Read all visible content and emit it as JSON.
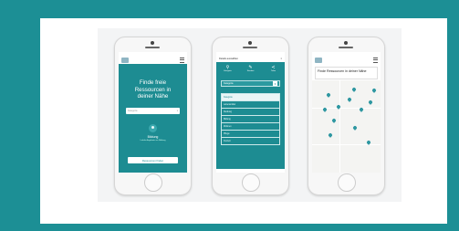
{
  "phone1": {
    "headline_line1": "Finde freie",
    "headline_line2": "Ressourcen in",
    "headline_line3": "deiner Nähe",
    "select_value": "Kategorie",
    "category": "Bildung",
    "category_sub": "Lokale Angebote zur Bildung",
    "button": "Ressourcen finden"
  },
  "phone2": {
    "dialog_title": "Details auswählen",
    "close": "×",
    "tabs": [
      "Kategorie",
      "Standort",
      "Teilen"
    ],
    "tab_icons": [
      "people-icon",
      "tools-icon",
      "share-icon"
    ],
    "dropdown_value": "Kategorie",
    "options": [
      "Kategorie",
      "Lebensmittel",
      "Kleidung",
      "Bildung",
      "Wohnen",
      "Pflege",
      "Freizeit"
    ]
  },
  "phone3": {
    "title": "Finde Ressourcen in deiner Nähe"
  },
  "colors": {
    "teal": "#1d8c92",
    "frame": "#1c8f95"
  }
}
